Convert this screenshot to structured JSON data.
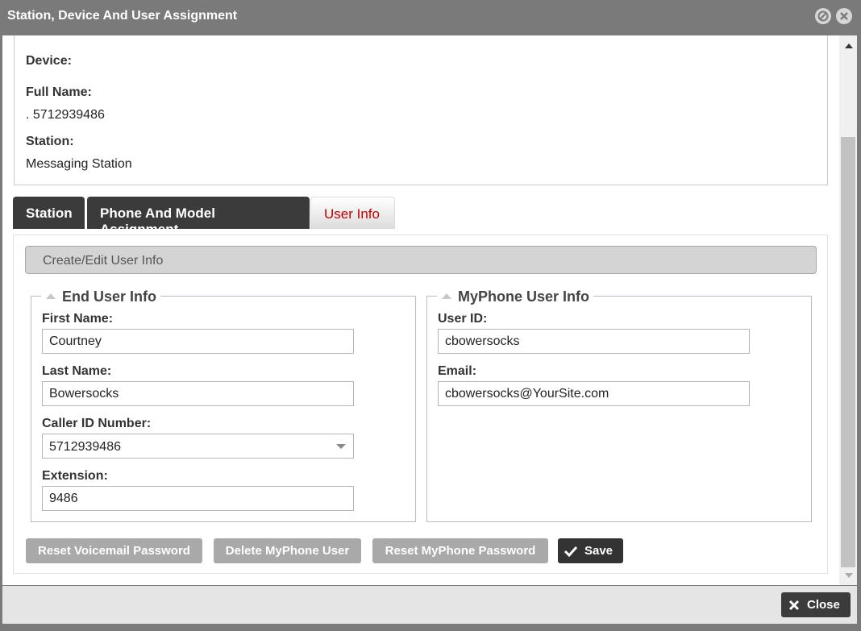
{
  "window": {
    "title": "Station, Device And User Assignment"
  },
  "summary": {
    "top_partial_value": "5712939486",
    "device_label": "Device:",
    "full_name_label": "Full Name:",
    "full_name_value": ". 5712939486",
    "station_label": "Station:",
    "station_value": "Messaging Station"
  },
  "tabs": [
    {
      "label": "Station"
    },
    {
      "label": "Phone And Model Assignment"
    },
    {
      "label": "User Info",
      "active": true
    }
  ],
  "panel": {
    "header": "Create/Edit User Info",
    "end_user": {
      "legend": "End User Info",
      "first_name_label": "First Name:",
      "first_name_value": "Courtney",
      "last_name_label": "Last Name:",
      "last_name_value": "Bowersocks",
      "caller_id_label": "Caller ID Number:",
      "caller_id_value": "5712939486",
      "extension_label": "Extension:",
      "extension_value": "9486"
    },
    "myphone": {
      "legend": "MyPhone User Info",
      "user_id_label": "User ID:",
      "user_id_value": "cbowersocks",
      "email_label": "Email:",
      "email_value": "cbowersocks@YourSite.com"
    },
    "buttons": {
      "reset_voicemail": "Reset Voicemail Password",
      "delete_myphone": "Delete MyPhone User",
      "reset_myphone": "Reset MyPhone Password",
      "save": "Save"
    }
  },
  "footer": {
    "close_label": "Close"
  },
  "colors": {
    "active_tab_text": "#c00000",
    "title_bar": "#7a7a7a",
    "dark_button": "#333333",
    "disabled_button": "#a9a9a9"
  }
}
